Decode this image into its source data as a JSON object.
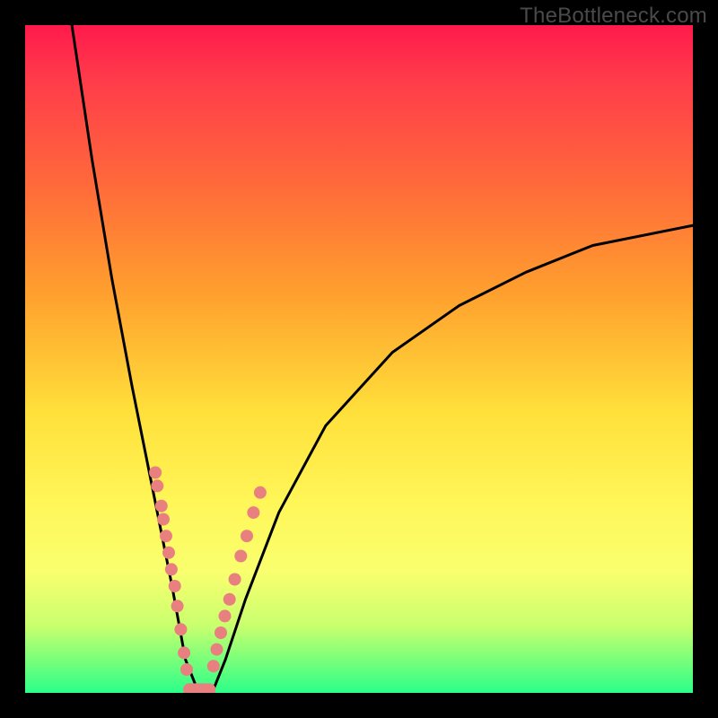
{
  "watermark": {
    "text": "TheBottleneck.com"
  },
  "chart_data": {
    "type": "line",
    "title": "",
    "xlabel": "",
    "ylabel": "",
    "xlim": [
      0,
      100
    ],
    "ylim": [
      0,
      100
    ],
    "description": "V-shaped bottleneck curve; y decreases from ~100 at x≈7 to 0 near x≈24–28 then rises toward ~70 at x=100. Background hue maps y from green (0) to red (100).",
    "series": [
      {
        "name": "bottleneck-curve",
        "x": [
          7,
          10,
          13,
          16,
          19,
          22,
          24,
          26,
          28,
          30,
          33,
          38,
          45,
          55,
          65,
          75,
          85,
          100
        ],
        "y": [
          100,
          80,
          62,
          46,
          31,
          16,
          5,
          0,
          0,
          5,
          14,
          27,
          40,
          51,
          58,
          63,
          67,
          70
        ]
      }
    ],
    "markers": {
      "name": "highlight-dots",
      "color": "#e98080",
      "points_left": [
        [
          19.5,
          33
        ],
        [
          19.8,
          31
        ],
        [
          20.4,
          28
        ],
        [
          20.7,
          26
        ],
        [
          21.1,
          23.5
        ],
        [
          21.5,
          21
        ],
        [
          21.9,
          18.5
        ],
        [
          22.4,
          16
        ],
        [
          22.8,
          13
        ],
        [
          23.3,
          9.5
        ],
        [
          23.8,
          6
        ],
        [
          24.2,
          3.5
        ]
      ],
      "points_right": [
        [
          28.2,
          4
        ],
        [
          28.7,
          6.5
        ],
        [
          29.3,
          9
        ],
        [
          29.9,
          11.5
        ],
        [
          30.6,
          14
        ],
        [
          31.4,
          17
        ],
        [
          32.3,
          20.5
        ],
        [
          33.2,
          23.5
        ],
        [
          34.2,
          27
        ],
        [
          35.2,
          30
        ]
      ],
      "bottom_bar": [
        [
          24.6,
          0.5
        ],
        [
          25.1,
          0.5
        ],
        [
          25.6,
          0.5
        ],
        [
          26.1,
          0.5
        ],
        [
          26.6,
          0.5
        ],
        [
          27.1,
          0.5
        ],
        [
          27.6,
          0.5
        ]
      ]
    }
  }
}
